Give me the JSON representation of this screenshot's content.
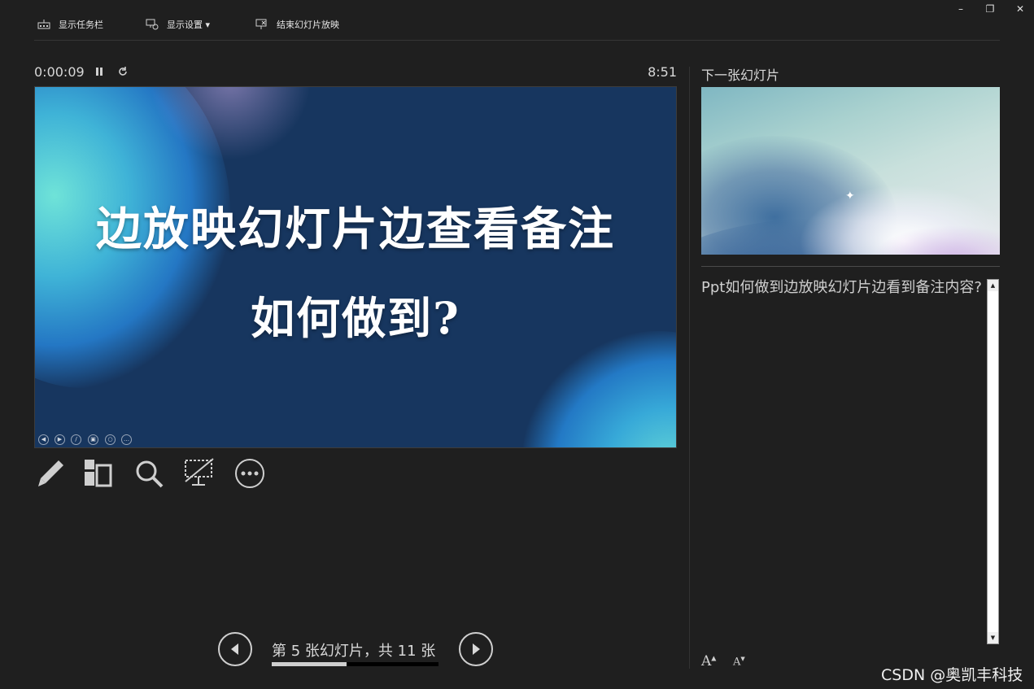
{
  "window": {
    "minimize_icon": "minimize-icon",
    "restore_icon": "restore-icon",
    "close_icon": "close-icon",
    "minimize_glyph": "–",
    "restore_glyph": "❐",
    "close_glyph": "✕"
  },
  "toolbar": {
    "taskbar_label": "显示任务栏",
    "display_settings_label": "显示设置 ▾",
    "end_show_label": "结束幻灯片放映"
  },
  "presenter": {
    "elapsed_time": "0:00:09",
    "clock": "8:51"
  },
  "current_slide": {
    "title_line1": "边放映幻灯片边查看备注",
    "title_line2": "如何做到?"
  },
  "navigation": {
    "counter_text": "第 5 张幻灯片，共 11 张",
    "current": 5,
    "total": 11,
    "progress_fraction": 0.45
  },
  "next_slide": {
    "label": "下一张幻灯片"
  },
  "notes": {
    "text": "Ppt如何做到边放映幻灯片边看到备注内容?"
  },
  "font_buttons": {
    "increase_label": "A",
    "decrease_label": "A"
  },
  "watermark": "CSDN @奥凯丰科技",
  "colors": {
    "background": "#1f1f1f",
    "slide_background": "#17365f",
    "text": "#d0d0d0"
  }
}
